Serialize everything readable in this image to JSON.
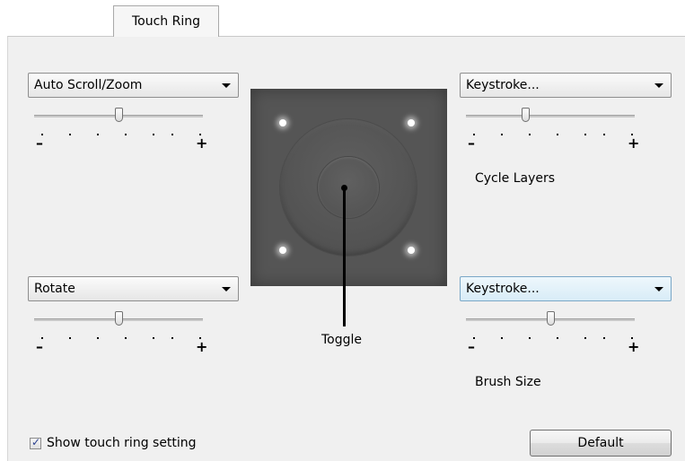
{
  "tab": {
    "label": "Touch Ring"
  },
  "left_top": {
    "dropdown": "Auto Scroll/Zoom",
    "slider_level": 0.5
  },
  "left_bottom": {
    "dropdown": "Rotate",
    "slider_level": 0.5
  },
  "right_top": {
    "dropdown": "Keystroke...",
    "caption": "Cycle Layers",
    "slider_level": 0.35
  },
  "right_bottom": {
    "dropdown": "Keystroke...",
    "caption": "Brush Size",
    "slider_level": 0.5
  },
  "slider_labels": {
    "minus": "–",
    "plus": "+"
  },
  "ring": {
    "center_label": "Toggle"
  },
  "checkbox": {
    "label": "Show touch ring setting",
    "checked": true
  },
  "default_button": {
    "label": "Default"
  },
  "colors": {
    "panel_bg": "#f0f0f0",
    "ring_bg": "#555555",
    "focused_dropdown": "#d8ecf7"
  }
}
